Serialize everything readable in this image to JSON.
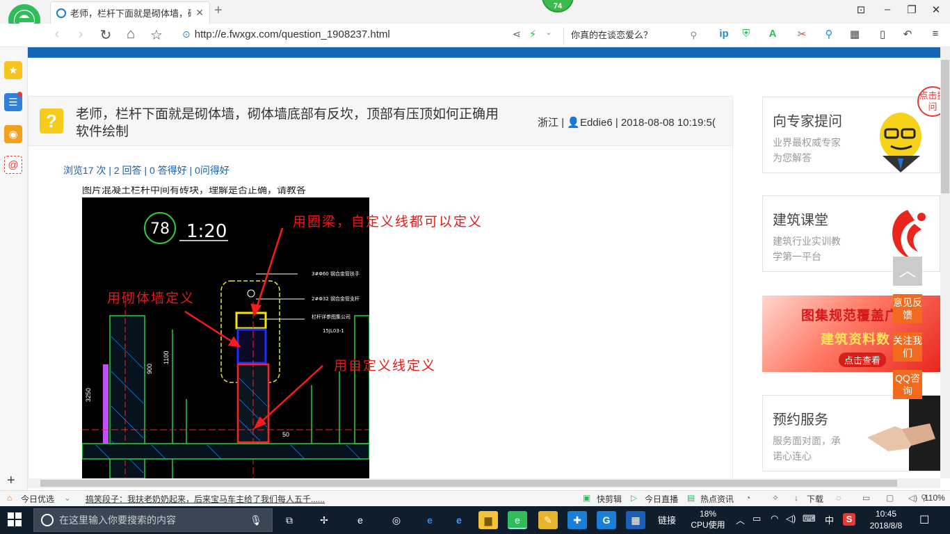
{
  "browser": {
    "tab_title": "老师，栏杆下面就是砌体墙，砌体墙底部有反坎，顶部有压顶如何正确用软件绘制",
    "badge_count": "74",
    "url": "http://e.fwxgx.com/question_1908237.html",
    "search_text": "你真的在谈恋爱么？",
    "new_tab": "+",
    "window_controls": [
      "⊡",
      "–",
      "❐",
      "✕"
    ]
  },
  "question": {
    "title": "老师，栏杆下面就是砌体墙，砌体墙底部有反坎，顶部有压顶如何正确用软件绘制",
    "region": "浙江",
    "separator": "|",
    "user": "Eddie6",
    "datetime": "2018-08-08 10:19:5(",
    "stats": "浏览17 次 | 2 回答 | 0 答得好 | 0问得好"
  },
  "cad": {
    "top_text": "图片混凝土栏杆中间有砖块，理解是否正确，请教各",
    "scale_number": "78",
    "scale_ratio": "1:20",
    "annotations": {
      "ring_beam": "用圈梁，自定义线都可以定义",
      "masonry": "用砌体墙定义",
      "custom_line": "用自定义线定义"
    }
  },
  "sidebar_right": {
    "expert": {
      "title": "向专家提问",
      "subtitle": "业界最权威专家为您解答",
      "bubble": "点击提问"
    },
    "classroom": {
      "title": "建筑课堂",
      "subtitle": "建筑行业实训教学第一平台"
    },
    "banner": {
      "line1": "图集规范覆盖广",
      "line2": "建筑资料数",
      "button": "点击查看"
    },
    "appointment": {
      "title": "预约服务",
      "subtitle": "服务面对面，承诺心连心"
    }
  },
  "float_buttons": {
    "feedback": "意见反馈",
    "follow": "关注我们",
    "qq": "QQ咨询"
  },
  "statusbar": {
    "today_pick": "今日优选",
    "headline": "搞笑段子：我扶老奶奶起来，后来宝马车主给了我们每人五千......",
    "items": [
      "快剪辑",
      "今日直播",
      "热点资讯",
      "下载"
    ],
    "zoom": "110%"
  },
  "taskbar": {
    "search_placeholder": "在这里输入你要搜索的内容",
    "links": "链接",
    "cpu_percent": "18%",
    "cpu_label": "CPU使用",
    "ime": "中",
    "time": "10:45",
    "date": "2018/8/8"
  },
  "colors": {
    "brand_blue": "#1565b7",
    "accent_orange": "#f26a1e",
    "question_yellow": "#f7cb1a",
    "annotation_red": "#e81818"
  }
}
